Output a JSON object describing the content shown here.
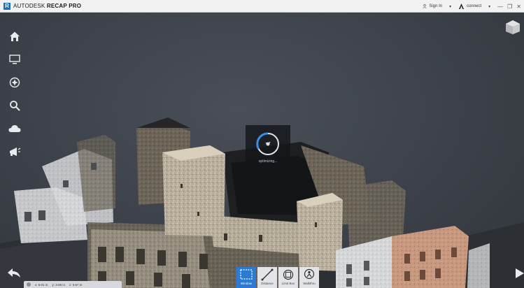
{
  "titlebar": {
    "logo_letter": "R",
    "app_name_brand": "AUTODESK",
    "app_name_product": "RECAP PRO",
    "sign_in": "Sign In",
    "account": "connect",
    "window_controls": [
      "—",
      "❐",
      "✕"
    ]
  },
  "left_toolbar": {
    "icons": [
      "home-icon",
      "display-icon",
      "navigation-icon",
      "search-icon",
      "cloud-icon",
      "megaphone-icon"
    ]
  },
  "overlay": {
    "status": "optimizing..."
  },
  "status_bar": {
    "x": "x: 5.01 m",
    "y": "y: 3.08 m",
    "z": "z: 0.57 m"
  },
  "bottom_tools": [
    {
      "label": "Window",
      "active": true
    },
    {
      "label": "Distance",
      "active": false
    },
    {
      "label": "Limit Box",
      "active": false
    },
    {
      "label": "Walkthru",
      "active": false
    }
  ],
  "colors": {
    "accent": "#2b7bd6",
    "viewport_bg": "#3b4048",
    "titlebar_bg": "#f2f2f2"
  }
}
